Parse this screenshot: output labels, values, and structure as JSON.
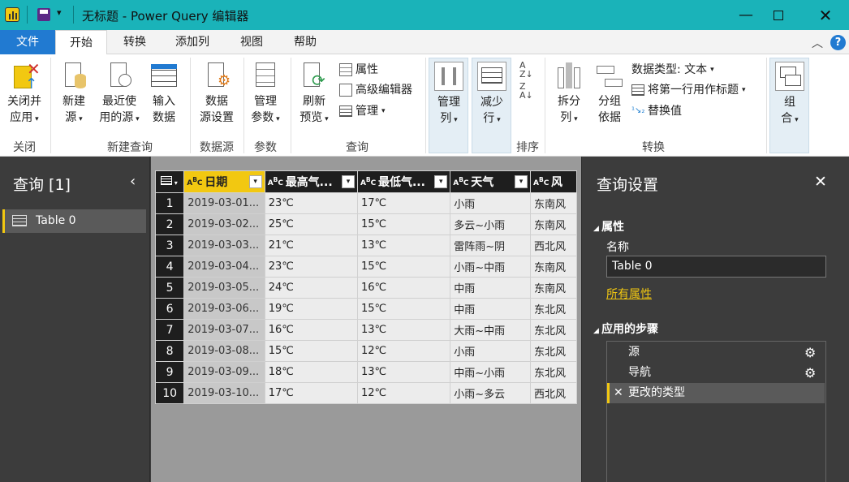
{
  "title": "无标题 - Power Query 编辑器",
  "menu": [
    "文件",
    "开始",
    "转换",
    "添加列",
    "视图",
    "帮助"
  ],
  "ribbon": {
    "close_apply": [
      "关闭并",
      "应用"
    ],
    "new_source": [
      "新建",
      "源"
    ],
    "recent_sources": [
      "最近使",
      "用的源"
    ],
    "enter_data": [
      "输入",
      "数据"
    ],
    "datasource_settings": [
      "数据",
      "源设置"
    ],
    "manage_params": [
      "管理",
      "参数"
    ],
    "refresh_preview": [
      "刷新",
      "预览"
    ],
    "properties": "属性",
    "advanced_editor": "高级编辑器",
    "manage": "管理",
    "manage_cols": [
      "管理",
      "列"
    ],
    "reduce_rows": [
      "减少",
      "行"
    ],
    "split_col": [
      "拆分",
      "列"
    ],
    "group_by": [
      "分组",
      "依据"
    ],
    "data_type": "数据类型: 文本",
    "first_row_header": "将第一行用作标题",
    "replace_values": "替换值",
    "combine": [
      "组",
      "合"
    ],
    "groups": [
      "关闭",
      "新建查询",
      "数据源",
      "参数",
      "查询",
      "排序",
      "转换"
    ]
  },
  "left": {
    "title": "查询 [1]",
    "queries": [
      "Table 0"
    ]
  },
  "grid": {
    "headers": [
      "日期",
      "最高气...",
      "最低气...",
      "天气",
      "风"
    ],
    "rows": [
      [
        "2019-03-01...",
        "23℃",
        "17℃",
        "小雨",
        "东南风"
      ],
      [
        "2019-03-02...",
        "25℃",
        "15℃",
        "多云~小雨",
        "东南风"
      ],
      [
        "2019-03-03...",
        "21℃",
        "13℃",
        "雷阵雨~阴",
        "西北风"
      ],
      [
        "2019-03-04...",
        "23℃",
        "15℃",
        "小雨~中雨",
        "东南风"
      ],
      [
        "2019-03-05...",
        "24℃",
        "16℃",
        "中雨",
        "东南风"
      ],
      [
        "2019-03-06...",
        "19℃",
        "15℃",
        "中雨",
        "东北风"
      ],
      [
        "2019-03-07...",
        "16℃",
        "13℃",
        "大雨~中雨",
        "东北风"
      ],
      [
        "2019-03-08...",
        "15℃",
        "12℃",
        "小雨",
        "东北风"
      ],
      [
        "2019-03-09...",
        "18℃",
        "13℃",
        "中雨~小雨",
        "东北风"
      ],
      [
        "2019-03-10...",
        "17℃",
        "12℃",
        "小雨~多云",
        "西北风"
      ]
    ]
  },
  "right": {
    "title": "查询设置",
    "props_section": "属性",
    "name_label": "名称",
    "name_value": "Table 0",
    "all_props": "所有属性",
    "steps_section": "应用的步骤",
    "steps": [
      "源",
      "导航",
      "更改的类型"
    ]
  },
  "colors": {
    "titlebar": "#1ab3b9",
    "accent": "#f2c811",
    "file_tab": "#217ad1"
  }
}
